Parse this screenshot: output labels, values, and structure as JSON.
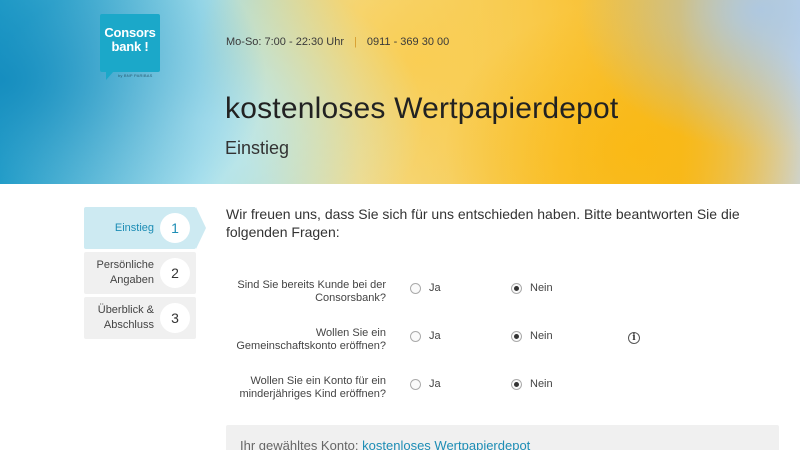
{
  "brand": {
    "logo_line1": "Consors",
    "logo_line2": "bank !",
    "logo_sub": "by BNP PARIBAS",
    "colors": {
      "logo": "#1ba8c9",
      "accent": "#1d8db5",
      "active_step_bg": "#cdeaf2"
    }
  },
  "header": {
    "hours": "Mo-So: 7:00 - 22:30 Uhr",
    "separator": "|",
    "phone": "0911 - 369 30 00",
    "title": "kostenloses Wertpapierdepot",
    "subtitle": "Einstieg"
  },
  "steps": [
    {
      "label": "Einstieg",
      "number": "1",
      "active": true
    },
    {
      "label": "Persönliche Angaben",
      "number": "2",
      "active": false
    },
    {
      "label": "Überblick & Abschluss",
      "number": "3",
      "active": false
    }
  ],
  "intro": "Wir freuen uns, dass Sie sich für uns entschieden haben. Bitte beantworten Sie die folgenden Fragen:",
  "questions": [
    {
      "label": "Sind Sie bereits Kunde bei der Consorsbank?",
      "option_yes": "Ja",
      "option_no": "Nein",
      "selected": "Nein",
      "info_icon": false
    },
    {
      "label": "Wollen Sie ein Gemeinschaftskonto eröffnen?",
      "option_yes": "Ja",
      "option_no": "Nein",
      "selected": "Nein",
      "info_icon": true
    },
    {
      "label": "Wollen Sie ein Konto für ein minderjähriges Kind eröffnen?",
      "option_yes": "Ja",
      "option_no": "Nein",
      "selected": "Nein",
      "info_icon": false
    }
  ],
  "summary": {
    "prefix": "Ihr gewähltes Konto:",
    "account_link": "kostenloses Wertpapierdepot"
  },
  "icons": {
    "info": "info-icon"
  }
}
